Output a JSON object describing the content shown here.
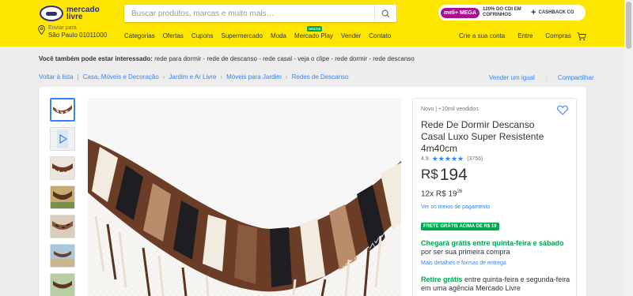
{
  "header": {
    "logo_text_line1": "mercado",
    "logo_text_line2": "livre",
    "search_placeholder": "Buscar produtos, marcas e muito mais…",
    "promo": {
      "meli_label": "meli+ MEGA",
      "text": "120% DO CDI EM COFRINHOS",
      "plus": "+",
      "cashback": "CASHBACK CO"
    },
    "location": {
      "line1": "Enviar para",
      "line2": "São Paulo 01011000"
    },
    "nav": [
      "Categorias",
      "Ofertas",
      "Cupons",
      "Supermercado",
      "Moda",
      "Mercado Play",
      "Vender",
      "Contato"
    ],
    "nav_badge": "GRÁTIS",
    "user_nav": [
      "Crie a sua conta",
      "Entre",
      "Compras"
    ]
  },
  "related": {
    "label": "Você também pode estar interessado:",
    "terms": "rede para dormir - rede de descanso - rede casal - veja o clipe - rede dormir - rede descanso"
  },
  "breadcrumb": {
    "back": "Voltar à lista",
    "items": [
      "Casa, Móveis e Decoração",
      "Jardim e Ar Livre",
      "Móveis para Jardim",
      "Redes de Descanso"
    ],
    "sell_same": "Vender um igual",
    "share": "Compartilhar"
  },
  "product": {
    "condition": "Novo  |  +10mil vendidos",
    "title": "Rede De Dormir Descanso Casal Luxo Super Resistente 4m40cm",
    "rating": "4.9",
    "stars": "★★★★★",
    "reviews": "(3756)",
    "currency": "R$",
    "price": "194",
    "installments_prefix": "12x R$ 19",
    "installments_cents": "26",
    "payment_link": "Ver os meios de pagamento",
    "free_badge": "FRETE GRÁTIS ACIMA DE R$ 19",
    "shipping_highlight": "Chegará grátis entre quinta-feira e sábado",
    "shipping_rest": " por ser sua primeira compra",
    "shipping_link": "Mais detalhes e formas de entrega",
    "pickup_highlight": "Retire grátis",
    "pickup_rest": " entre quinta-feira e segunda-feira em uma agência Mercado Livre"
  },
  "colors": {
    "brand_yellow": "#ffe600",
    "link_blue": "#3483fa",
    "green": "#00a650"
  }
}
